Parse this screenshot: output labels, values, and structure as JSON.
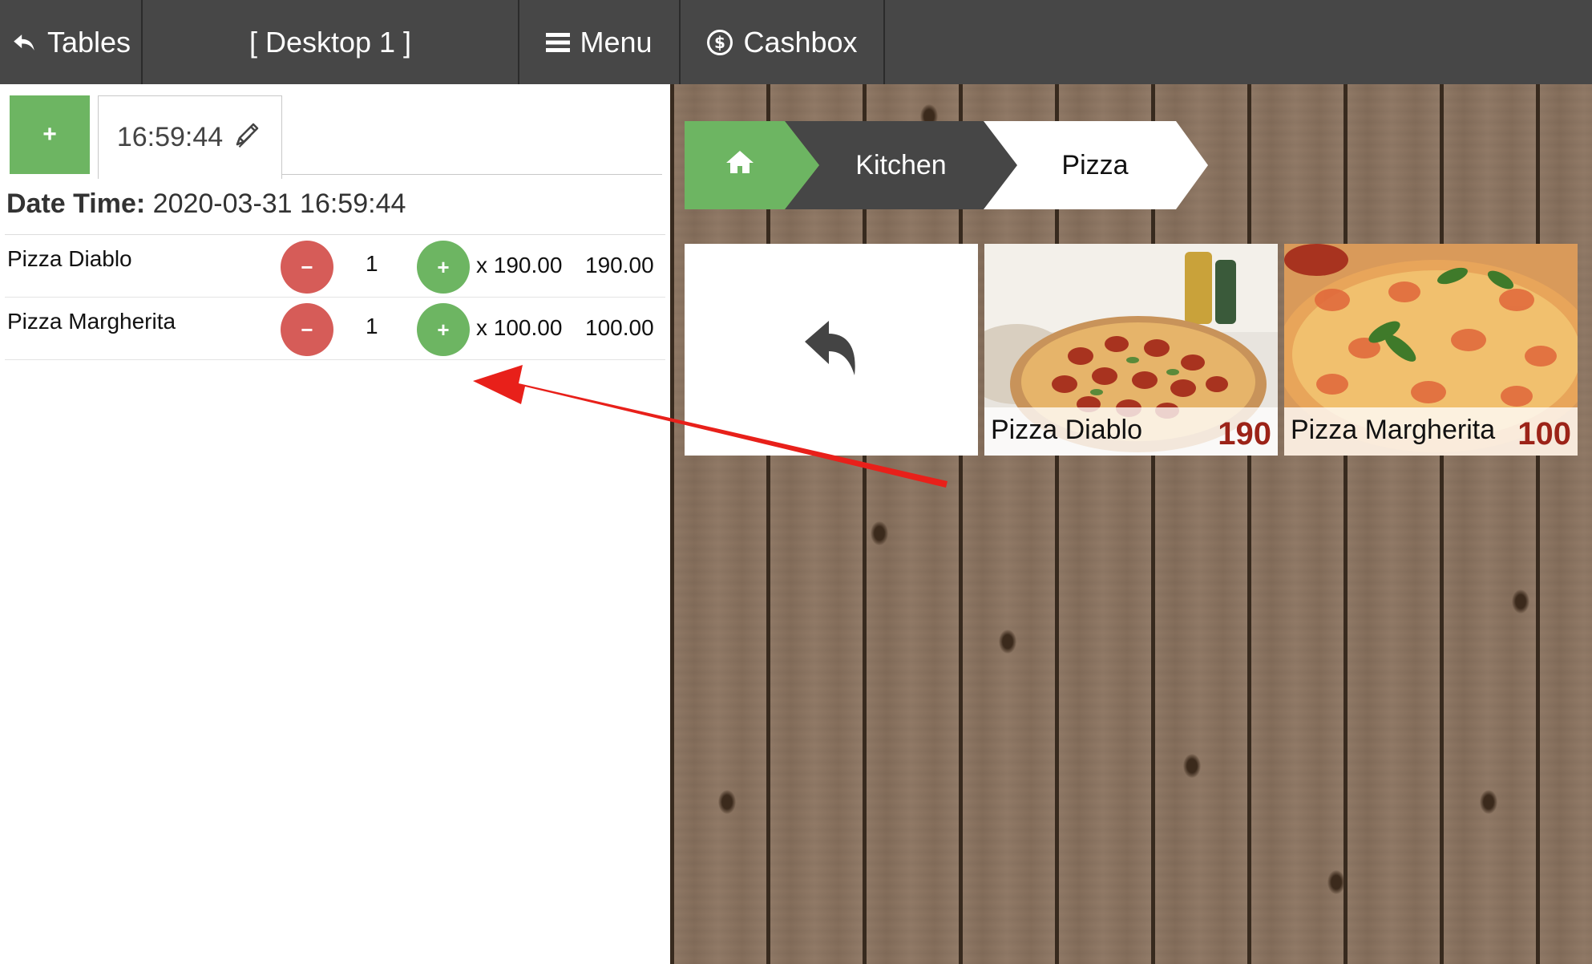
{
  "topbar": {
    "tables_label": "Tables",
    "desktop_label": "[ Desktop 1 ]",
    "menu_label": "Menu",
    "cashbox_label": "Cashbox"
  },
  "order": {
    "add_tab_label": "+",
    "tab_time": "16:59:44",
    "datetime_label": "Date Time:",
    "datetime_value": "2020-03-31 16:59:44",
    "items": [
      {
        "name": "Pizza Diablo",
        "qty": "1",
        "unit_price": "x 190.00",
        "total": "190.00",
        "minus": "−",
        "plus": "+"
      },
      {
        "name": "Pizza Margherita",
        "qty": "1",
        "unit_price": "x 100.00",
        "total": "100.00",
        "minus": "−",
        "plus": "+"
      }
    ]
  },
  "breadcrumb": {
    "home_icon": "home-icon",
    "items": [
      "Kitchen",
      "Pizza"
    ]
  },
  "products": [
    {
      "name": "Pizza Diablo",
      "price": "190"
    },
    {
      "name": "Pizza Margherita",
      "price": "100"
    }
  ],
  "colors": {
    "topbar": "#474747",
    "green": "#6db562",
    "red": "#d65c58",
    "price_red": "#9c2318",
    "annotation_arrow": "#e8201a"
  }
}
